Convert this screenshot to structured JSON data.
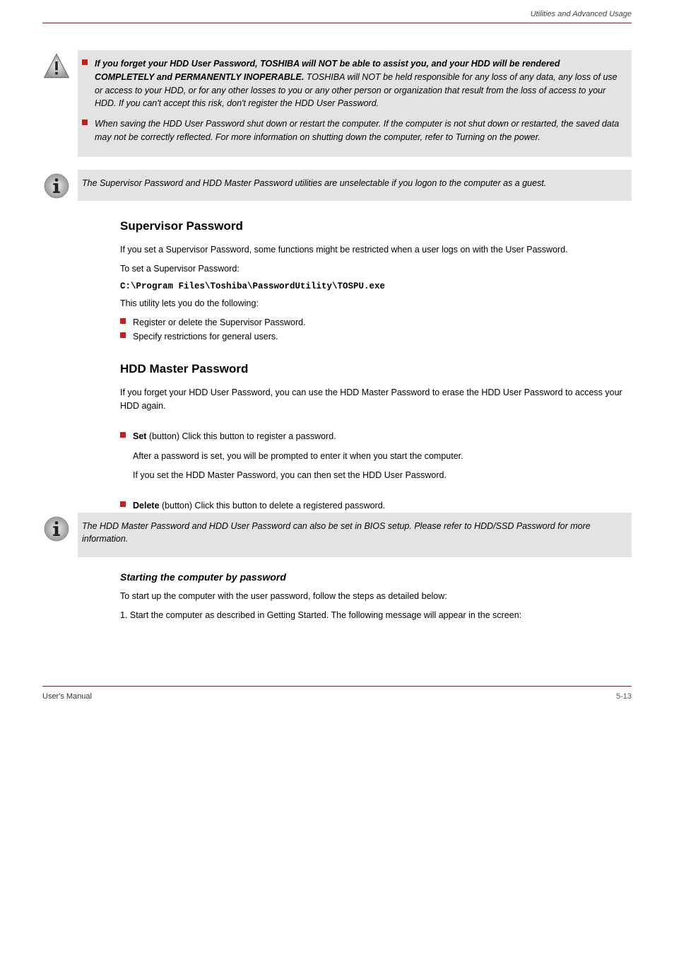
{
  "header": {
    "chapter": "Utilities and Advanced Usage"
  },
  "warning_box": {
    "items": [
      {
        "lead": "If you forget your HDD User Password, TOSHIBA will NOT be able to assist you, and your HDD will be rendered COMPLETELY and PERMANENTLY INOPERABLE.",
        "rest": " TOSHIBA will NOT be held responsible for any loss of any data, any loss of use or access to your HDD, or for any other losses to you or any other person or organization that result from the loss of access to your HDD. If you can't accept this risk, don't register the HDD User Password."
      },
      {
        "lead": "",
        "rest": "When saving the HDD User Password shut down or restart the computer. If the computer is not shut down or restarted, the saved data may not be correctly reflected. For more information on shutting down the computer, refer to ",
        "link": "Turning on the power",
        "tail": "."
      }
    ]
  },
  "note_simple": {
    "text": "The Supervisor Password and HDD Master Password utilities are unselectable if you logon to the computer as a guest."
  },
  "supervisor": {
    "title": "Supervisor Password",
    "p1": "If you set a Supervisor Password, some functions might be restricted when a user logs on with the User Password.",
    "p2": "To set a Supervisor Password:",
    "path": "C:\\Program Files\\Toshiba\\PasswordUtility\\TOSPU.exe",
    "p3": "This utility lets you do the following:",
    "list": [
      "Register or delete the Supervisor Password.",
      "Specify restrictions for general users."
    ]
  },
  "hdd_master": {
    "title": "HDD Master Password",
    "p1": "If you forget your HDD User Password, you can use the HDD Master Password to erase the HDD User Password to access your HDD again.",
    "field1_label": "Set",
    "field1_body": " (button) Click this button to register a password.",
    "field1_p2": "After a password is set, you will be prompted to enter it when you start the computer.",
    "field1_p3": "If you set the HDD Master Password, you can then set the HDD User Password.",
    "field2_label": "Delete",
    "field2_body": " (button) Click this button to delete a registered password.",
    "note": "The HDD Master Password and HDD User Password can also be set in BIOS setup. Please refer to ",
    "note_link": "HDD/SSD Password",
    "note_tail": " for more information."
  },
  "start_pw": {
    "title": "Starting the computer by password",
    "p1": "To start up the computer with the user password, follow the steps as detailed below:",
    "step": "1. Start the computer as described in ",
    "step_link": "Getting Started",
    "step_tail": ". The following message will appear in the screen:"
  },
  "footer": {
    "left": "User's Manual",
    "right": "5-13"
  }
}
